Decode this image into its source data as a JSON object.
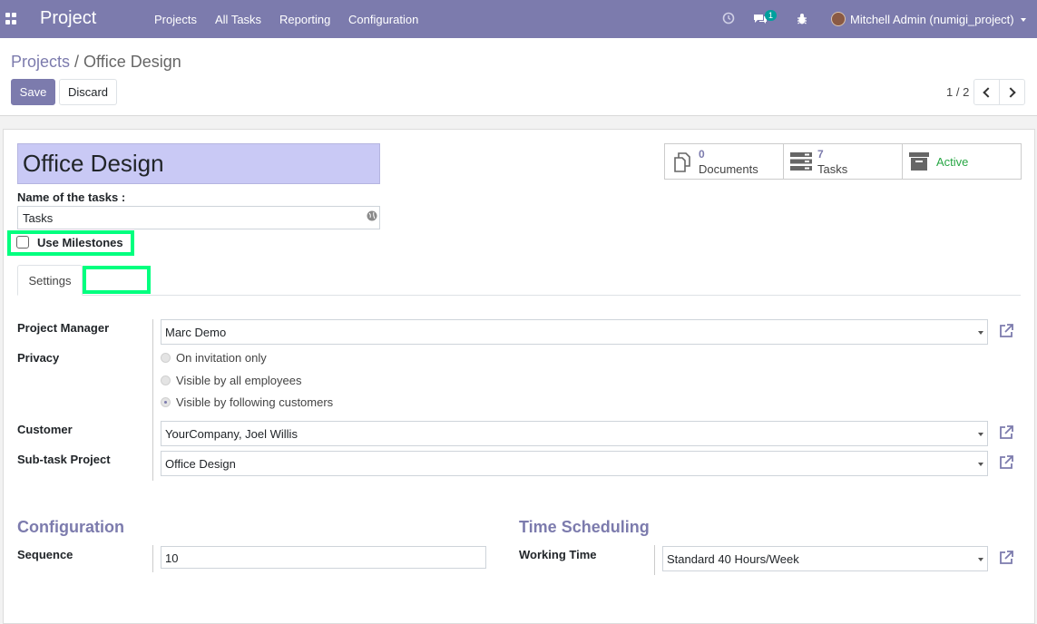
{
  "navbar": {
    "app_name": "Project",
    "menu": [
      "Projects",
      "All Tasks",
      "Reporting",
      "Configuration"
    ],
    "chat_badge": "1",
    "user": "Mitchell Admin (numigi_project)",
    "color": "#7c7bad"
  },
  "breadcrumb": {
    "parent": "Projects",
    "separator": "/",
    "current": "Office Design"
  },
  "actions": {
    "save": "Save",
    "discard": "Discard"
  },
  "pager": {
    "value": "1 / 2"
  },
  "form": {
    "title": "Office Design",
    "task_name_label": "Name of the tasks :",
    "task_name_value": "Tasks",
    "milestones_label": "Use Milestones",
    "milestones_checked": false,
    "tabs": [
      "Settings"
    ],
    "stats": [
      {
        "num": "0",
        "label": "Documents",
        "icon": "documents-icon"
      },
      {
        "num": "7",
        "label": "Tasks",
        "icon": "tasks-icon"
      },
      {
        "label": "Active",
        "icon": "archive-icon"
      }
    ],
    "project_manager_label": "Project Manager",
    "project_manager_value": "Marc Demo",
    "privacy_label": "Privacy",
    "privacy_options": [
      "On invitation only",
      "Visible by all employees",
      "Visible by following customers"
    ],
    "privacy_selected": 2,
    "customer_label": "Customer",
    "customer_value": "YourCompany, Joel Willis",
    "subtask_label": "Sub-task Project",
    "subtask_value": "Office Design",
    "config_title": "Configuration",
    "sequence_label": "Sequence",
    "sequence_value": "10",
    "time_title": "Time Scheduling",
    "working_time_label": "Working Time",
    "working_time_value": "Standard 40 Hours/Week"
  }
}
